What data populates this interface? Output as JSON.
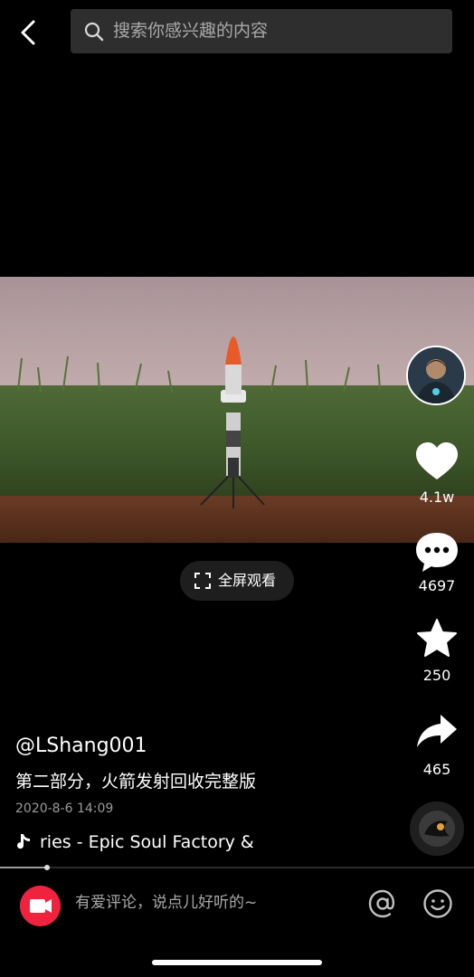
{
  "top": {
    "search_placeholder": "搜索你感兴趣的内容"
  },
  "video": {
    "fullscreen_label": "全屏观看"
  },
  "rail": {
    "likes": "4.1w",
    "comments": "4697",
    "favorites": "250",
    "shares": "465"
  },
  "post": {
    "author": "@LShang001",
    "title": "第二部分，火箭发射回收完整版",
    "date": "2020-8-6 14:09",
    "music": "ries - Epic Soul Factory &",
    "progress_fraction": 0.1
  },
  "bottom": {
    "comment_placeholder": "有爱评论，说点儿好听的~"
  },
  "icons": {
    "back": "chevron-left-icon",
    "search": "search-icon",
    "fullscreen": "fullscreen-icon",
    "like": "heart-icon",
    "comment": "comment-bubble-icon",
    "favorite": "star-icon",
    "share": "share-arrow-icon",
    "music": "music-note-icon",
    "record": "video-camera-icon",
    "mention": "at-icon",
    "emoji": "smiley-icon"
  },
  "colors": {
    "background": "#000000",
    "record_button": "#f0233f",
    "search_bg": "#2e2e2e"
  }
}
